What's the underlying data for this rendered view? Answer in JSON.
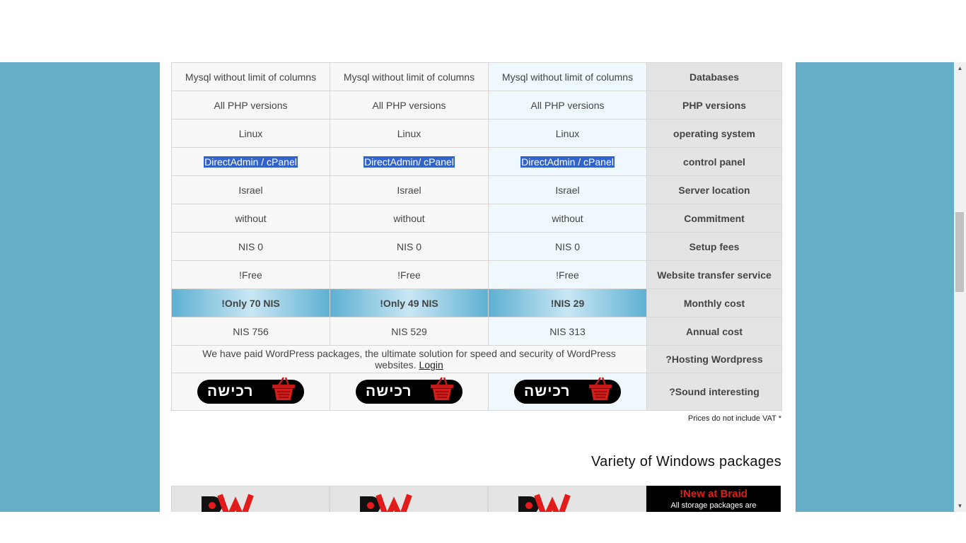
{
  "rows": [
    {
      "header": "Databases",
      "values": [
        "Mysql without limit of columns",
        "Mysql without limit of columns",
        "Mysql without limit of columns"
      ]
    },
    {
      "header": "PHP versions",
      "values": [
        "All PHP versions",
        "All PHP versions",
        "All PHP versions"
      ]
    },
    {
      "header": "operating system",
      "values": [
        "Linux",
        "Linux",
        "Linux"
      ]
    },
    {
      "header": "control panel",
      "values": [
        "DirectAdmin / cPanel",
        "DirectAdmin/ cPanel",
        "DirectAdmin / cPanel"
      ]
    },
    {
      "header": "Server location",
      "values": [
        "Israel",
        "Israel",
        "Israel"
      ]
    },
    {
      "header": "Commitment",
      "values": [
        "without",
        "without",
        "without"
      ]
    },
    {
      "header": "Setup fees",
      "values": [
        "NIS 0",
        "NIS 0",
        "NIS 0"
      ]
    },
    {
      "header": "Website transfer service",
      "values": [
        "!Free",
        "!Free",
        "!Free"
      ]
    },
    {
      "header": "Monthly cost",
      "values": [
        "!Only 70 NIS",
        "!Only 49 NIS",
        "!NIS 29"
      ]
    },
    {
      "header": "Annual cost",
      "values": [
        "NIS 756",
        "NIS 529",
        "NIS 313"
      ]
    }
  ],
  "wordpress": {
    "header": "?Hosting Wordpress",
    "text": "We have paid WordPress packages, the ultimate solution for speed and security of WordPress websites.",
    "link": "Login"
  },
  "purchase": {
    "header": "?Sound interesting",
    "button_label": "רכישה"
  },
  "vat_note": "Prices do not include VAT *",
  "windows_section": {
    "title": "Variety of Windows packages",
    "new_title": "!New at Braid",
    "new_text": "All storage packages are"
  },
  "colors": {
    "page_background": "#66adc8",
    "header_cell": "#e4e4e4",
    "highlight": "#3263c8",
    "price_gradient": "#5eb0d3"
  },
  "icons": [
    "basket-icon",
    "braid-w-logo",
    "scroll-up-arrow-icon",
    "scroll-down-arrow-icon"
  ]
}
